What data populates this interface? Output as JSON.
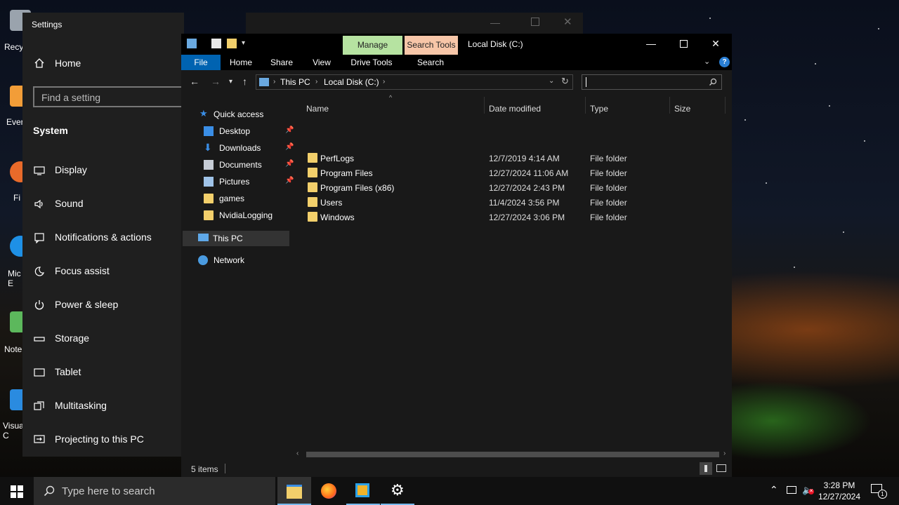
{
  "desktop": {
    "icons": [
      {
        "label": "Recy",
        "color": "#9aa3ad"
      },
      {
        "label": "Ever",
        "color": "#f29d38"
      },
      {
        "label": "Fi",
        "color": "#e86a2a"
      },
      {
        "label": "Mic\nE",
        "color": "#1e90e6"
      },
      {
        "label": "Note",
        "color": "#5cb85c"
      },
      {
        "label": "Visua\nC",
        "color": "#2a8be0"
      }
    ]
  },
  "settings": {
    "title": "Settings",
    "home": "Home",
    "search_placeholder": "Find a setting",
    "section": "System",
    "items": [
      {
        "label": "Display",
        "icon": "display-icon"
      },
      {
        "label": "Sound",
        "icon": "sound-icon"
      },
      {
        "label": "Notifications & actions",
        "icon": "notifications-icon"
      },
      {
        "label": "Focus assist",
        "icon": "focus-assist-icon"
      },
      {
        "label": "Power & sleep",
        "icon": "power-icon"
      },
      {
        "label": "Storage",
        "icon": "storage-icon"
      },
      {
        "label": "Tablet",
        "icon": "tablet-icon"
      },
      {
        "label": "Multitasking",
        "icon": "multitasking-icon"
      },
      {
        "label": "Projecting to this PC",
        "icon": "projecting-icon"
      }
    ]
  },
  "explorer": {
    "title": "Local Disk (C:)",
    "context_tabs": [
      {
        "label": "Manage",
        "color": "#b6e3a1"
      },
      {
        "label": "Search Tools",
        "color": "#f7c6a8"
      }
    ],
    "ribbon_tabs": [
      "File",
      "Home",
      "Share",
      "View",
      "Drive Tools",
      "Search"
    ],
    "breadcrumb": [
      "This PC",
      "Local Disk (C:)"
    ],
    "search_placeholder": "",
    "nav": {
      "quick_access": "Quick access",
      "pinned": [
        {
          "label": "Desktop",
          "pinned": true,
          "color": "#3a8ee6"
        },
        {
          "label": "Downloads",
          "pinned": true,
          "color": "#3a8ee6"
        },
        {
          "label": "Documents",
          "pinned": true,
          "color": "#c7cdd6"
        },
        {
          "label": "Pictures",
          "pinned": true,
          "color": "#9fc3e8"
        },
        {
          "label": "games",
          "pinned": false,
          "color": "#f2cf6b"
        },
        {
          "label": "NvidiaLogging",
          "pinned": false,
          "color": "#f2cf6b"
        }
      ],
      "this_pc": "This PC",
      "network": "Network"
    },
    "columns": [
      "Name",
      "Date modified",
      "Type",
      "Size"
    ],
    "rows": [
      {
        "name": "PerfLogs",
        "date": "12/7/2019 4:14 AM",
        "type": "File folder"
      },
      {
        "name": "Program Files",
        "date": "12/27/2024 11:06 AM",
        "type": "File folder"
      },
      {
        "name": "Program Files (x86)",
        "date": "12/27/2024 2:43 PM",
        "type": "File folder"
      },
      {
        "name": "Users",
        "date": "11/4/2024 3:56 PM",
        "type": "File folder"
      },
      {
        "name": "Windows",
        "date": "12/27/2024 3:06 PM",
        "type": "File folder"
      }
    ],
    "status": "5 items",
    "accent": "#0063b1"
  },
  "taskbar": {
    "search_placeholder": "Type here to search",
    "time": "3:28 PM",
    "date": "12/27/2024",
    "notification_count": "1"
  }
}
